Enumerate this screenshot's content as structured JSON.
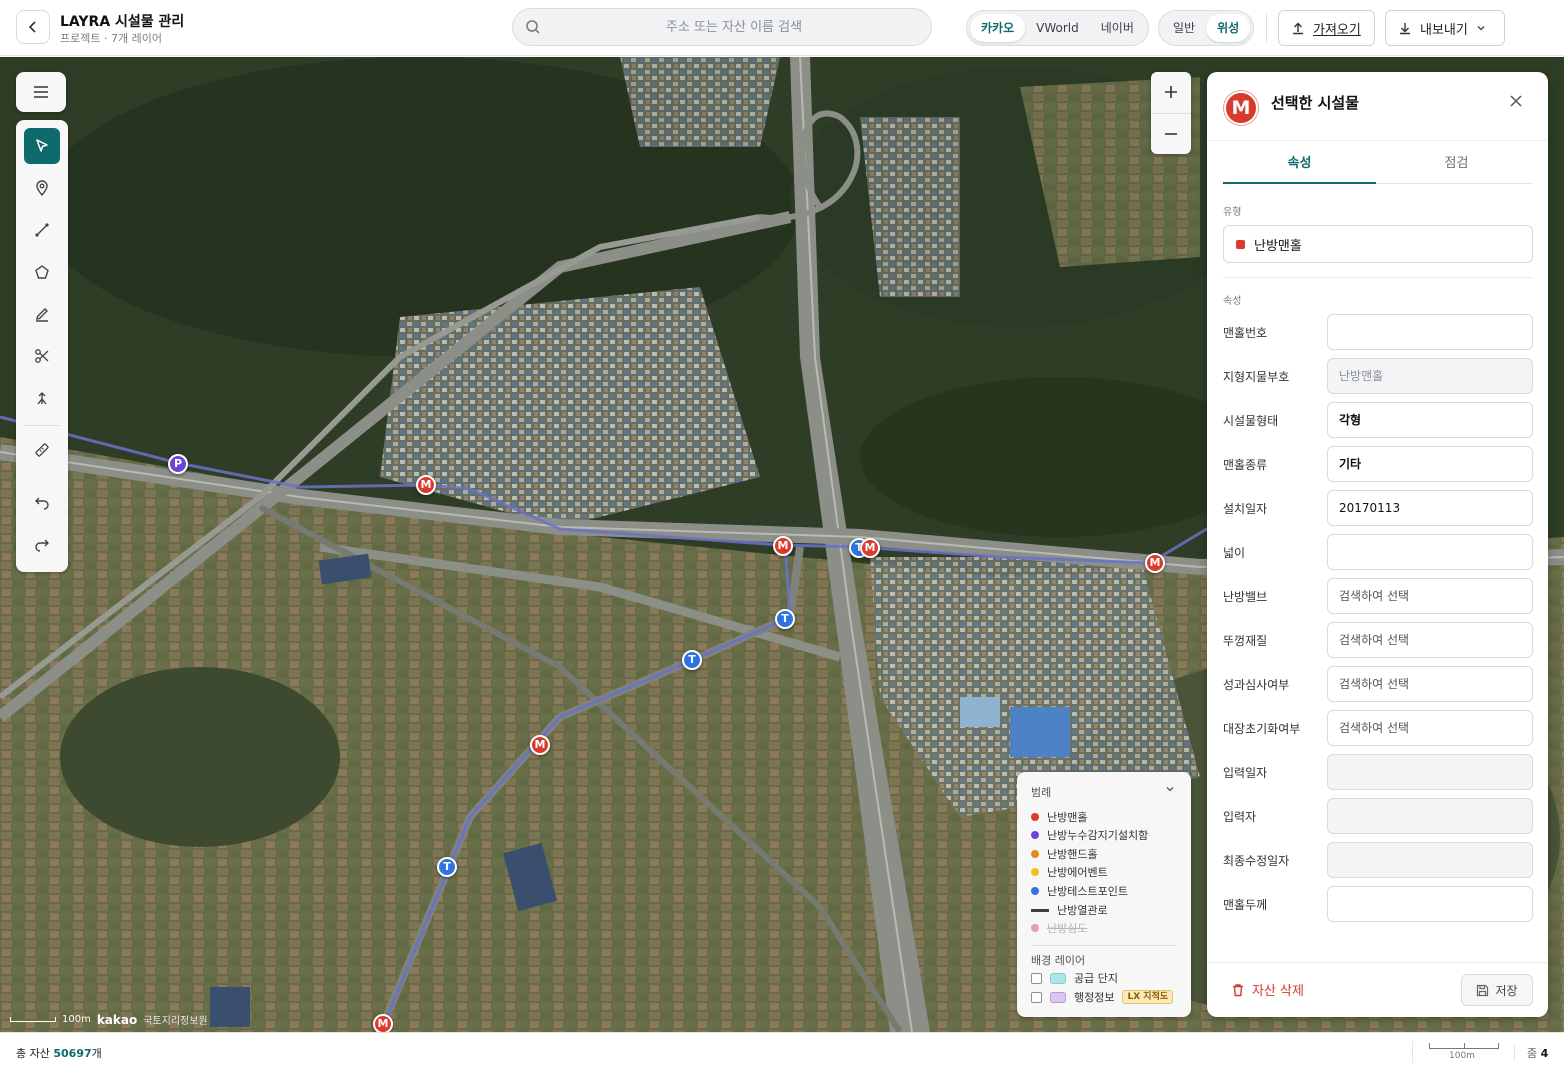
{
  "header": {
    "title": "LAYRA 시설물 관리",
    "subtitle": "프로젝트 · 7개 레이어",
    "search_placeholder": "주소 또는 자산 이름 검색",
    "providers": [
      "카카오",
      "VWorld",
      "네이버"
    ],
    "provider_selected": "카카오",
    "map_types": [
      "일반",
      "위성"
    ],
    "map_type_selected": "위성",
    "import_label": "가져오기",
    "export_label": "내보내기"
  },
  "toolbar": {
    "tools": [
      "select-icon",
      "pin-icon",
      "line-icon",
      "polygon-icon",
      "pen-icon",
      "scissors-icon",
      "split-icon",
      "ruler-icon",
      "undo-icon",
      "redo-icon"
    ],
    "active_tool": "select-icon"
  },
  "markers": [
    {
      "label": "P",
      "kind": "p"
    },
    {
      "label": "M",
      "kind": "m"
    },
    {
      "label": "M",
      "kind": "m"
    },
    {
      "label": "T",
      "kind": "t"
    },
    {
      "label": "M",
      "kind": "m"
    },
    {
      "label": "M",
      "kind": "m"
    },
    {
      "label": "T",
      "kind": "t"
    },
    {
      "label": "T",
      "kind": "t"
    },
    {
      "label": "M",
      "kind": "m"
    },
    {
      "label": "T",
      "kind": "t"
    },
    {
      "label": "M",
      "kind": "m"
    }
  ],
  "legend": {
    "title": "범례",
    "items": [
      {
        "label": "난방맨홀",
        "color": "#d93a2b",
        "type": "dot"
      },
      {
        "label": "난방누수감지기설치함",
        "color": "#6b46d6",
        "type": "dot"
      },
      {
        "label": "난방핸드홀",
        "color": "#e8871e",
        "type": "dot"
      },
      {
        "label": "난방에어벤트",
        "color": "#e8c21e",
        "type": "dot"
      },
      {
        "label": "난방테스트포인트",
        "color": "#2f73e0",
        "type": "dot"
      },
      {
        "label": "난방열관로",
        "color": "#3a4150",
        "type": "line"
      },
      {
        "label": "난방심도",
        "color": "#e89ac4",
        "type": "dot-disabled"
      }
    ],
    "bg_title": "배경 레이어",
    "bg_layers": [
      {
        "label": "공급 단지",
        "color": "#aee6e8"
      },
      {
        "label": "행정정보",
        "color": "#d9c6f2",
        "badge": "LX 지적도"
      }
    ]
  },
  "map_footer": {
    "scale_label": "100m",
    "brand": "kakao",
    "credit": "국토지리정보원"
  },
  "panel": {
    "badge": "M",
    "title": "선택한 시설물",
    "tabs": [
      "속성",
      "점검"
    ],
    "active_tab": "속성",
    "type_label": "유형",
    "type_value": "난방맨홀",
    "attr_label": "속성",
    "fields": [
      {
        "label": "맨홀번호",
        "value": "",
        "state": "empty"
      },
      {
        "label": "지형지물부호",
        "value": "난방맨홀",
        "state": "disabled"
      },
      {
        "label": "시설물형태",
        "value": "각형",
        "state": "bold"
      },
      {
        "label": "맨홀종류",
        "value": "기타",
        "state": "bold"
      },
      {
        "label": "설치일자",
        "value": "20170113",
        "state": "normal"
      },
      {
        "label": "넓이",
        "value": "",
        "state": "empty"
      },
      {
        "label": "난방밸브",
        "value": "검색하여 선택",
        "state": "placeholder"
      },
      {
        "label": "뚜껑재질",
        "value": "검색하여 선택",
        "state": "placeholder"
      },
      {
        "label": "성과심사여부",
        "value": "검색하여 선택",
        "state": "placeholder"
      },
      {
        "label": "대장초기화여부",
        "value": "검색하여 선택",
        "state": "placeholder"
      },
      {
        "label": "입력일자",
        "value": "",
        "state": "disabled"
      },
      {
        "label": "입력자",
        "value": "",
        "state": "disabled"
      },
      {
        "label": "최종수정일자",
        "value": "",
        "state": "disabled"
      },
      {
        "label": "맨홀두께",
        "value": "",
        "state": "empty"
      }
    ],
    "delete_label": "자산 삭제",
    "save_label": "저장"
  },
  "status": {
    "total_prefix": "총 자산",
    "total_count": "50697",
    "total_suffix": "개",
    "scale_label": "100m",
    "zoom_prefix": "줌",
    "zoom_value": "4"
  }
}
